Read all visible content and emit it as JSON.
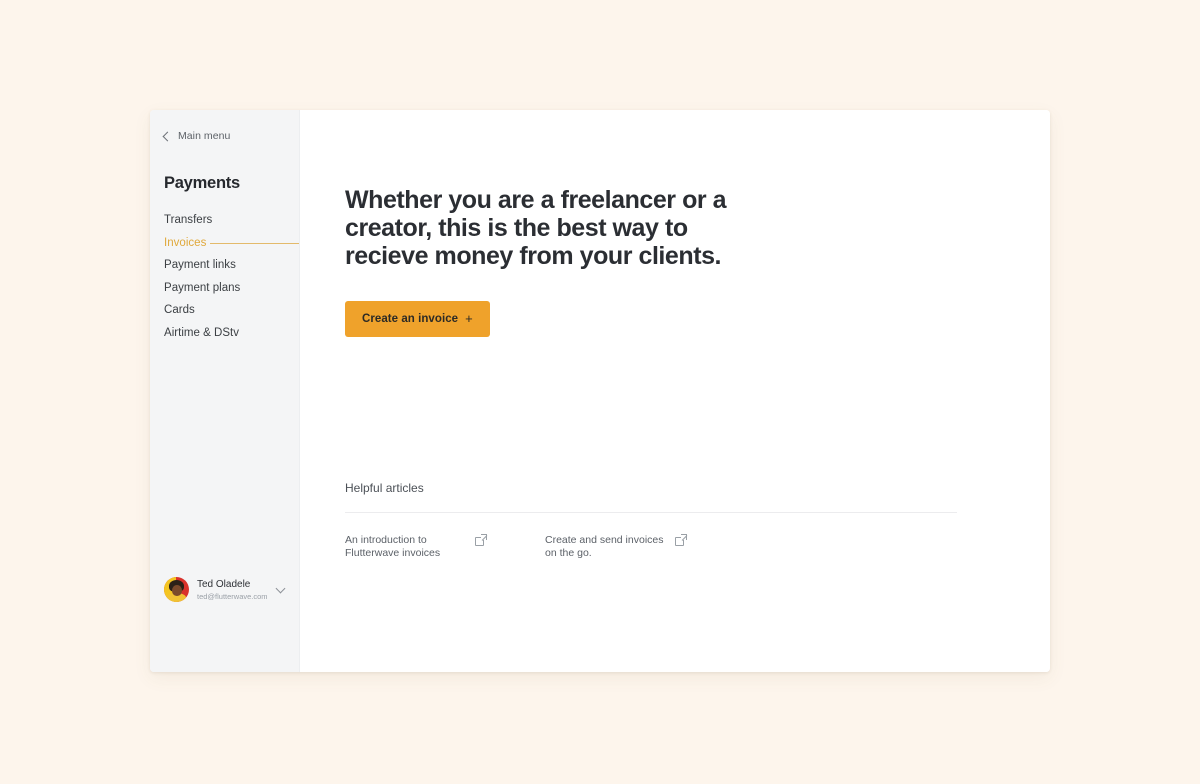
{
  "page": {
    "background_color": "#fdf5ec",
    "card_background": "#ffffff"
  },
  "sidebar": {
    "background_color": "#f4f5f6",
    "back": {
      "label": "Main menu",
      "icon": "chevron-left-icon"
    },
    "title": "Payments",
    "accent_color": "#e0a93c",
    "items": [
      {
        "label": "Transfers",
        "active": false
      },
      {
        "label": "Invoices",
        "active": true
      },
      {
        "label": "Payment links",
        "active": false
      },
      {
        "label": "Payment plans",
        "active": false
      },
      {
        "label": "Cards",
        "active": false
      },
      {
        "label": "Airtime & DStv",
        "active": false
      }
    ],
    "user": {
      "name": "Ted Oladele",
      "email": "ted@flutterwave.com",
      "avatar_alt": "user-avatar",
      "menu_icon": "chevron-down-icon"
    }
  },
  "main": {
    "heading": "Whether you are a freelancer or a creator, this is the best way to recieve money from your clients.",
    "cta": {
      "label": "Create an invoice",
      "plus_glyph": "+",
      "background_color": "#efa22b"
    },
    "articles": {
      "title": "Helpful articles",
      "items": [
        {
          "text": "An introduction to Flutterwave invoices",
          "icon": "external-link-icon"
        },
        {
          "text": "Create and send invoices on the go.",
          "icon": "external-link-icon"
        }
      ]
    }
  }
}
